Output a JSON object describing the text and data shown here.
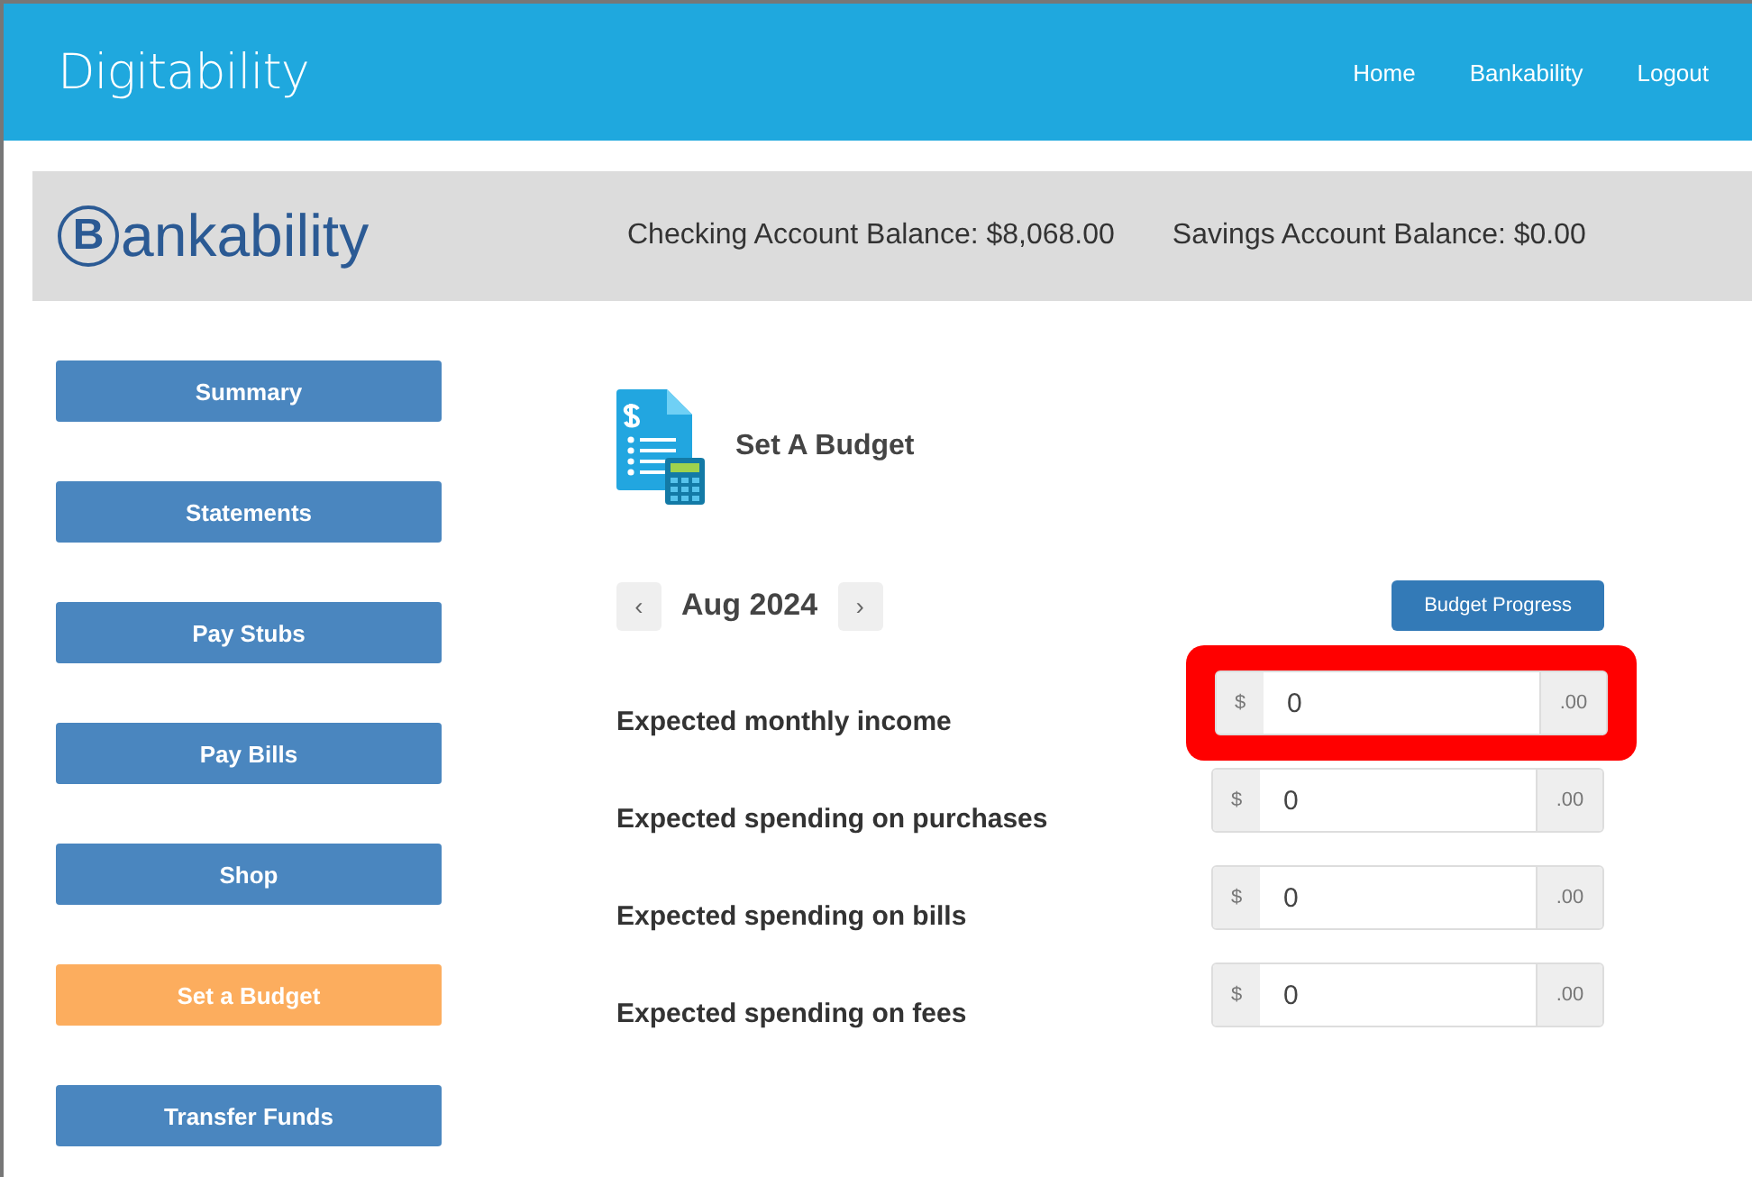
{
  "header": {
    "brand": "Digitability",
    "nav": [
      "Home",
      "Bankability",
      "Logout"
    ]
  },
  "account_bar": {
    "logo": "ankability",
    "logo_mark": "B",
    "balances": [
      "Checking Account Balance: $8,068.00",
      "Savings Account Balance: $0.00"
    ]
  },
  "sidebar": {
    "items": [
      {
        "label": "Summary",
        "selected": false
      },
      {
        "label": "Statements",
        "selected": false
      },
      {
        "label": "Pay Stubs",
        "selected": false
      },
      {
        "label": "Pay Bills",
        "selected": false
      },
      {
        "label": "Shop",
        "selected": false
      },
      {
        "label": "Set a Budget",
        "selected": true
      },
      {
        "label": "Transfer Funds",
        "selected": false
      }
    ]
  },
  "page": {
    "title": "Set A Budget",
    "month": {
      "prev": "‹",
      "label": "Aug 2024",
      "next": "›"
    },
    "progress_button": "Budget Progress"
  },
  "fields": [
    {
      "label": "Expected monthly income",
      "prefix": "$",
      "value": "0",
      "suffix": ".00",
      "highlighted": true
    },
    {
      "label": "Expected spending on purchases",
      "prefix": "$",
      "value": "0",
      "suffix": ".00",
      "highlighted": false
    },
    {
      "label": "Expected spending on bills",
      "prefix": "$",
      "value": "0",
      "suffix": ".00",
      "highlighted": false
    },
    {
      "label": "Expected spending on fees",
      "prefix": "$",
      "value": "0",
      "suffix": ".00",
      "highlighted": false
    }
  ]
}
